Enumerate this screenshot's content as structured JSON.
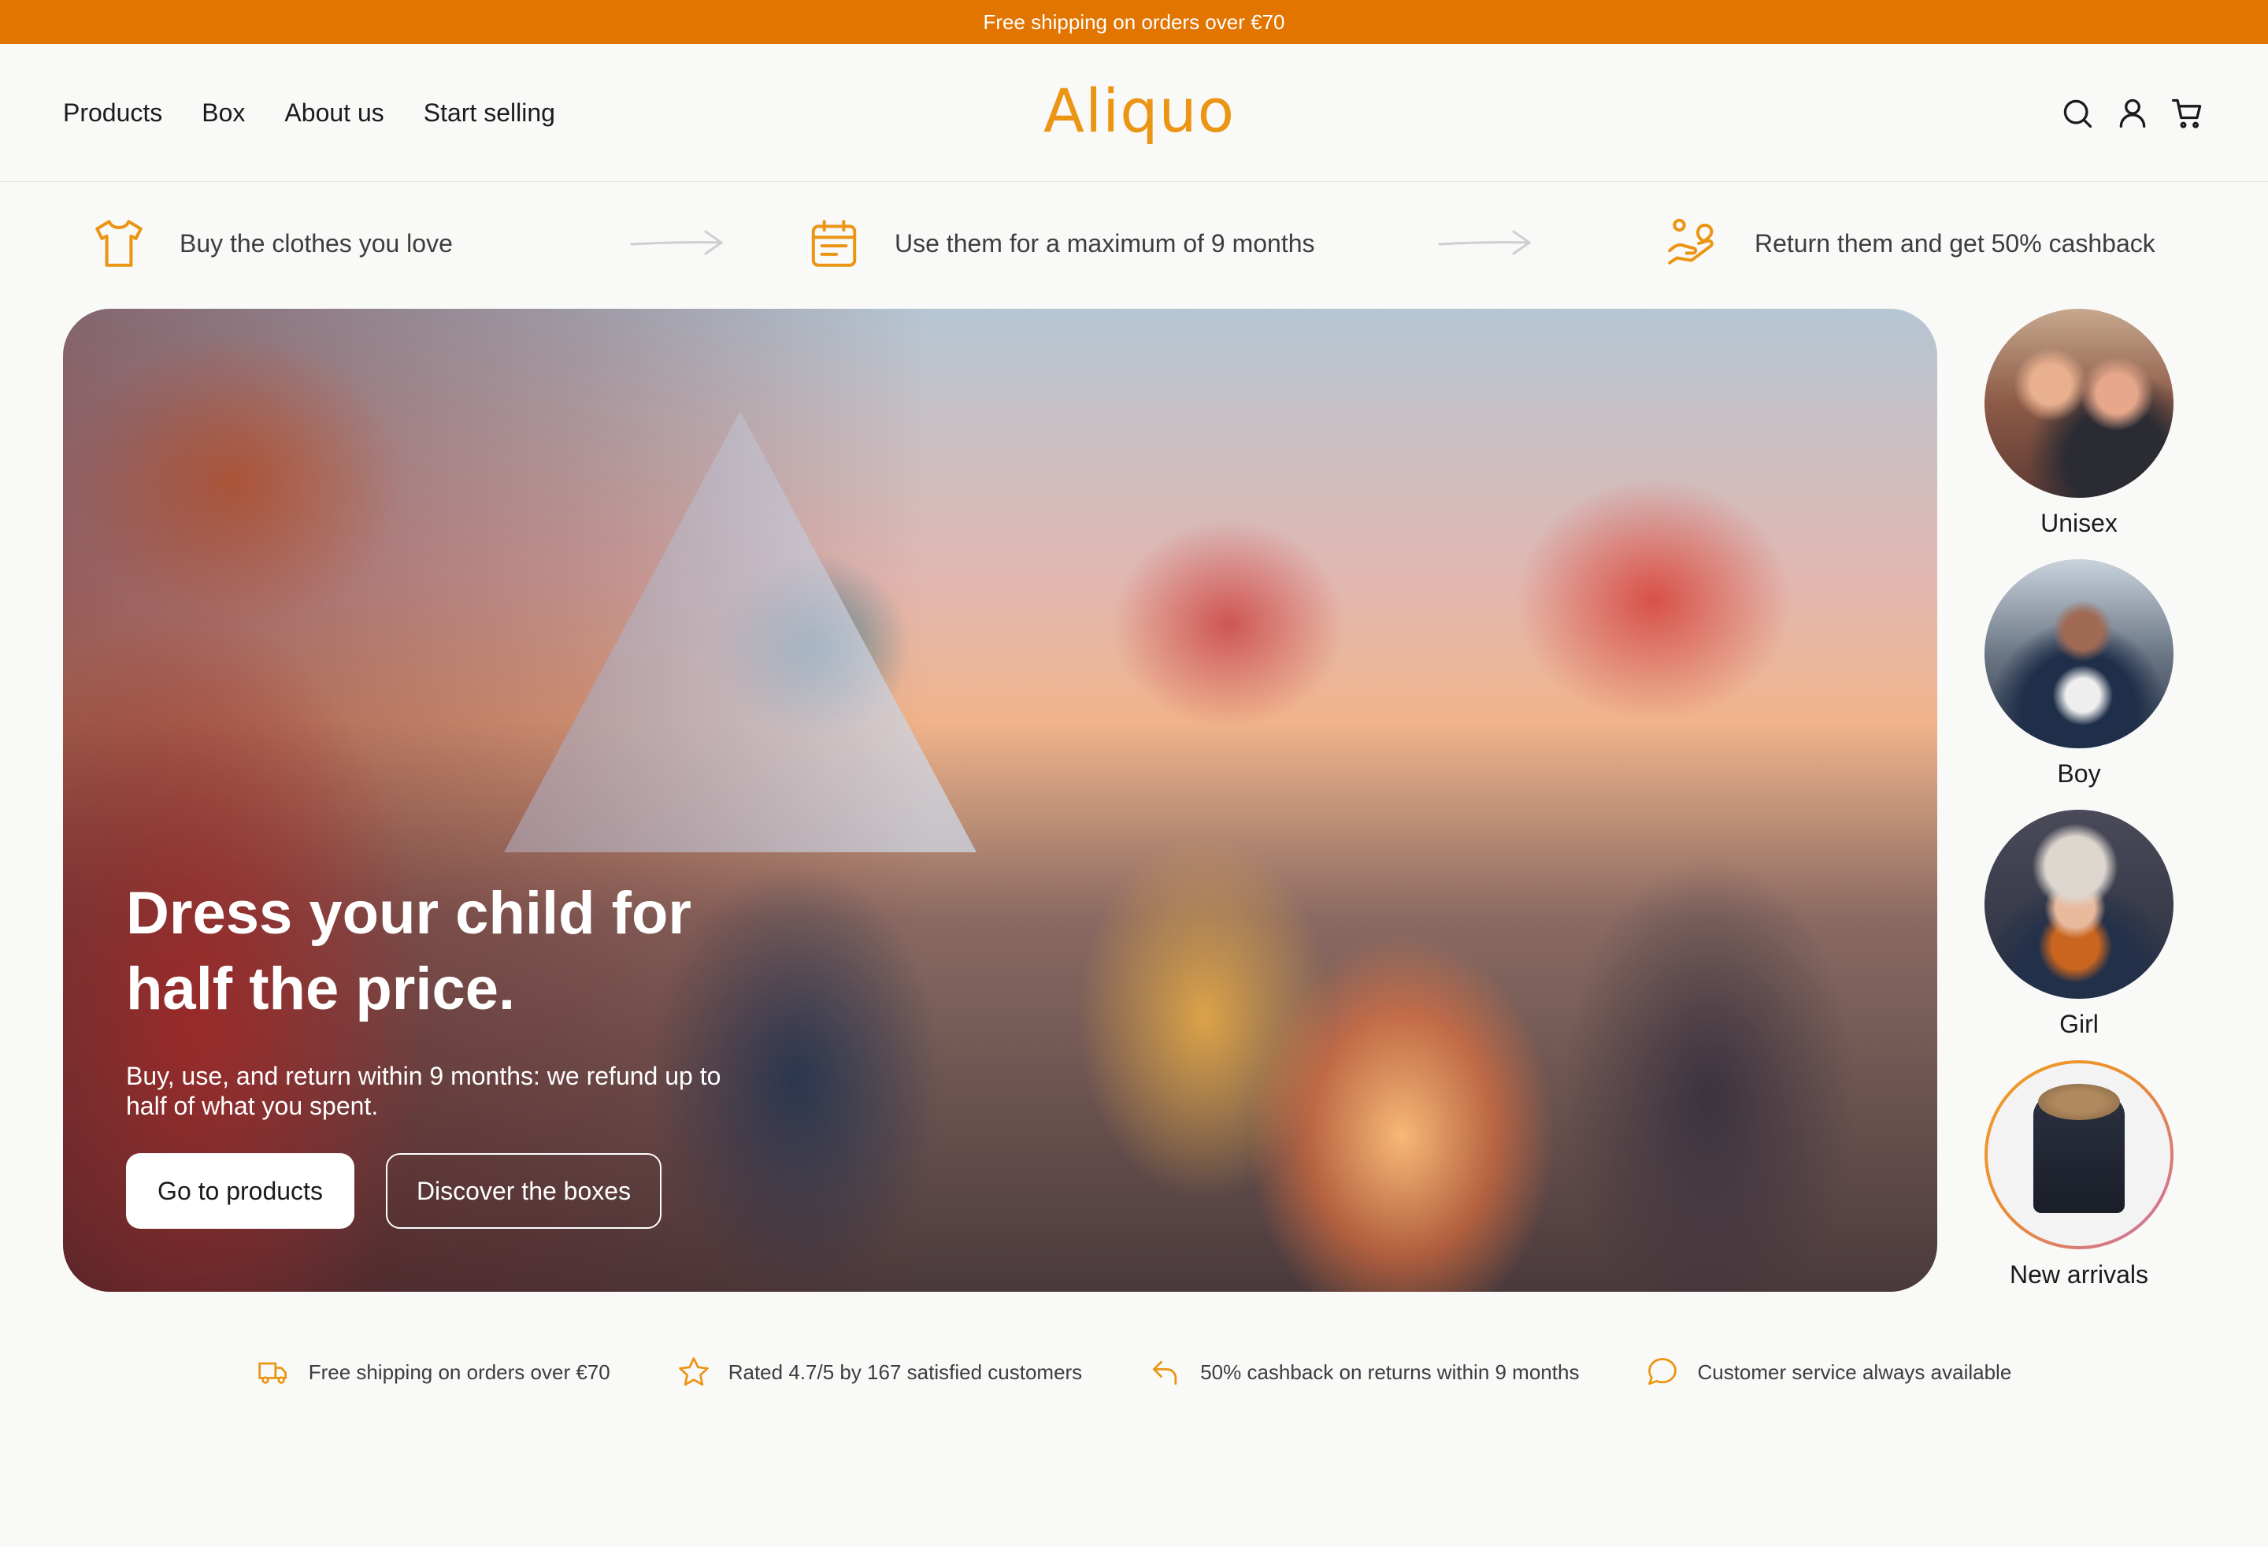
{
  "announcement": "Free shipping on orders over €70",
  "brand": {
    "logo": "Aliquo",
    "accent": "#e27400",
    "logo_color": "#eb9514"
  },
  "nav": [
    {
      "label": "Products"
    },
    {
      "label": "Box"
    },
    {
      "label": "About us"
    },
    {
      "label": "Start selling"
    }
  ],
  "header_icons": [
    "search-icon",
    "user-icon",
    "cart-icon"
  ],
  "steps": [
    {
      "icon": "tshirt-icon",
      "text": "Buy the clothes you love"
    },
    {
      "icon": "calendar-icon",
      "text": "Use them for a maximum of 9 months"
    },
    {
      "icon": "cashback-hand-icon",
      "text": "Return them and get 50% cashback"
    }
  ],
  "hero": {
    "title": "Dress your child for half the price.",
    "subtitle": "Buy, use, and return within 9 months: we refund up to half of what you spent.",
    "primary_button": "Go to products",
    "secondary_button": "Discover the boxes"
  },
  "categories": [
    {
      "label": "Unisex"
    },
    {
      "label": "Boy"
    },
    {
      "label": "Girl"
    },
    {
      "label": "New arrivals"
    }
  ],
  "trust": [
    {
      "icon": "truck-icon",
      "text": "Free shipping on orders over €70"
    },
    {
      "icon": "star-icon",
      "text": "Rated 4.7/5 by 167 satisfied customers"
    },
    {
      "icon": "return-arrow-icon",
      "text": "50% cashback on returns within 9 months"
    },
    {
      "icon": "chat-bubble-icon",
      "text": "Customer service always available"
    }
  ]
}
